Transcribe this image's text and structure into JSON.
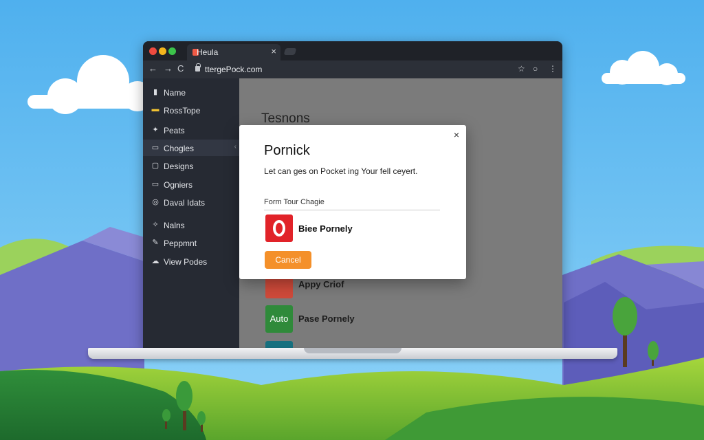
{
  "browser": {
    "tab_title": "Heula",
    "tab_close": "×",
    "url": "ttergePock.com",
    "nav_back": "←",
    "nav_forward": "→",
    "nav_reload": "C",
    "star": "☆",
    "extension": "○",
    "menu": "⋮"
  },
  "sidebar": {
    "items": [
      {
        "label": "Name",
        "icon": "▮"
      },
      {
        "label": "RossTope",
        "icon": "▬"
      },
      {
        "label": "Peats",
        "icon": "✦"
      },
      {
        "label": "Chogles",
        "icon": "▭",
        "chevron": "‹"
      },
      {
        "label": "Designs",
        "icon": "▢"
      },
      {
        "label": "Ogniers",
        "icon": "▭"
      },
      {
        "label": "Daval Idats",
        "icon": "◎"
      },
      {
        "label": "Nalns",
        "icon": "✧"
      },
      {
        "label": "Peppmnt",
        "icon": "✎"
      },
      {
        "label": "View Podes",
        "icon": "☁"
      }
    ]
  },
  "main": {
    "title": "Tesnons",
    "apps": [
      {
        "name": "Appy Criof",
        "tile_text": "",
        "color": "#d23a2a"
      },
      {
        "name": "Pase Pornely",
        "tile_text": "Auto",
        "color": "#2f8a3a"
      },
      {
        "name": "",
        "tile_text": "",
        "color": "#17707f"
      }
    ]
  },
  "dialog": {
    "title": "Pornick",
    "message": "Let can ges on Pocket ing Your fell ceyert.",
    "field_label": "Form Tour Chagie",
    "option_name": "Biee Pornely",
    "cancel_label": "Cancel",
    "close": "×"
  },
  "colors": {
    "accent": "#f4902a",
    "option_tile": "#e12329"
  }
}
